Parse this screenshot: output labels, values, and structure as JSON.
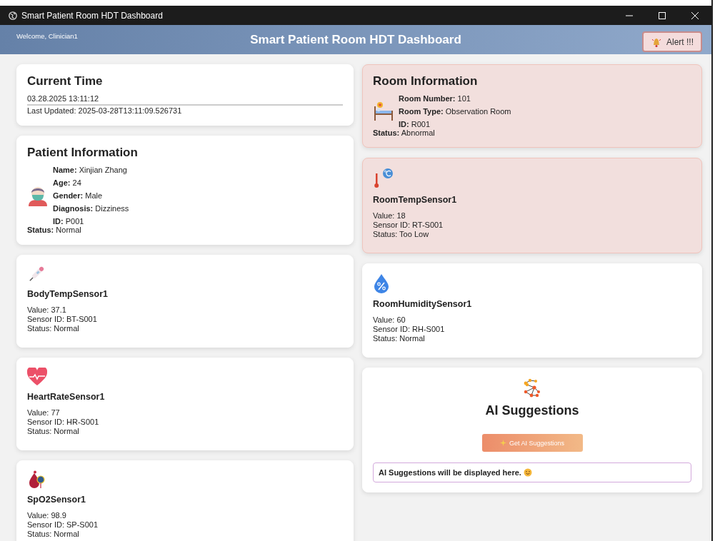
{
  "window": {
    "title": "Smart Patient Room HDT Dashboard"
  },
  "header": {
    "welcome": "Welcome, Clinician1",
    "title": "Smart Patient Room HDT Dashboard",
    "alert_button": "Alert !!!"
  },
  "current_time": {
    "title": "Current Time",
    "time": "03.28.2025 13:11:12",
    "last_updated": "Last Updated: 2025-03-28T13:11:09.526731"
  },
  "patient": {
    "title": "Patient Information",
    "fields": [
      "**Name:** Xinjian Zhang",
      "**Age:** 24",
      "**Gender:** Male",
      "**Diagnosis:** Dizziness",
      "**ID:** P001"
    ],
    "status": "**Status:** Normal",
    "abnormal": false
  },
  "room": {
    "title": "Room Information",
    "fields": [
      "**Room Number:** 101",
      "**Room Type:** Observation Room",
      "**ID:** R001"
    ],
    "status": "**Status:** Abnormal",
    "abnormal": true
  },
  "left_sensors": [
    {
      "kind": "body-temp",
      "name": "BodyTempSensor1",
      "value": "Value: 37.1",
      "sensor_id": "Sensor ID: BT-S001",
      "status": "Status: Normal",
      "abnormal": false
    },
    {
      "kind": "heart-rate",
      "name": "HeartRateSensor1",
      "value": "Value: 77",
      "sensor_id": "Sensor ID: HR-S001",
      "status": "Status: Normal",
      "abnormal": false
    },
    {
      "kind": "spo2",
      "name": "SpO2Sensor1",
      "value": "Value: 98.9",
      "sensor_id": "Sensor ID: SP-S001",
      "status": "Status: Normal",
      "abnormal": false
    }
  ],
  "right_sensors": [
    {
      "kind": "room-temp",
      "name": "RoomTempSensor1",
      "value": "Value: 18",
      "sensor_id": "Sensor ID: RT-S001",
      "status": "Status: Too Low",
      "abnormal": true
    },
    {
      "kind": "humidity",
      "name": "RoomHumiditySensor1",
      "value": "Value: 60",
      "sensor_id": "Sensor ID: RH-S001",
      "status": "Status: Normal",
      "abnormal": false
    }
  ],
  "ai": {
    "title": "AI Suggestions",
    "button": "Get AI Suggestions",
    "message": "AI Suggestions will be displayed here."
  }
}
